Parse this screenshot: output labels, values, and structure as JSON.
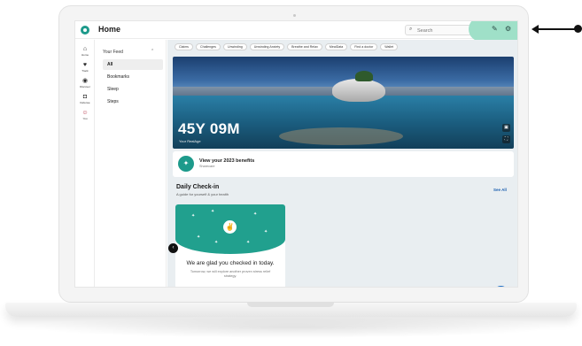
{
  "topbar": {
    "title": "Home",
    "search_placeholder": "Search",
    "search_icon": "search-icon",
    "actions": [
      "edit-icon",
      "gear-icon"
    ]
  },
  "rail": {
    "items": [
      {
        "label": "Home",
        "icon": "home-icon"
      },
      {
        "label": "Track",
        "icon": "heart-icon"
      },
      {
        "label": "Discover",
        "icon": "compass-icon"
      },
      {
        "label": "Defense",
        "icon": "shield-icon"
      },
      {
        "label": "You",
        "icon": "person-icon"
      }
    ]
  },
  "feed": {
    "header": "Your Feed",
    "items": [
      {
        "label": "All",
        "active": true
      },
      {
        "label": "Bookmarks",
        "active": false
      },
      {
        "label": "Sleep",
        "active": false
      },
      {
        "label": "Steps",
        "active": false
      }
    ]
  },
  "chips": [
    "Claims",
    "Challenges",
    "Unwinding",
    "Unwinding Anxiety",
    "Breathe and Relax",
    "MealData",
    "Find a doctor",
    "Wallet"
  ],
  "hero": {
    "age": "45Y 09M",
    "age_label": "Your RealAge"
  },
  "benefits": {
    "title": "View your 2023 benefits",
    "subtitle": "Sharecare"
  },
  "checkin": {
    "title": "Daily Check-in",
    "subtitle": "A guide for yourself & your health",
    "see_all": "See All",
    "card_title": "We are glad you checked in today.",
    "card_subtitle": "Tomorrow, we will explore another proven stress relief strategy."
  },
  "colors": {
    "brand": "#1d9a8b",
    "highlight": "#9fe0c8",
    "link": "#1b5fb0",
    "chat": "#1f6fc6"
  }
}
